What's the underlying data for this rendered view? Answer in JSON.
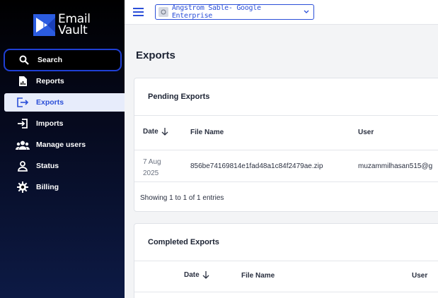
{
  "app": {
    "logo_line1": "Email",
    "logo_line2": "Vault"
  },
  "sidebar": {
    "items": [
      {
        "label": "Search",
        "icon": "search-icon"
      },
      {
        "label": "Reports",
        "icon": "report-icon"
      },
      {
        "label": "Exports",
        "icon": "export-icon"
      },
      {
        "label": "Imports",
        "icon": "import-icon"
      },
      {
        "label": "Manage users",
        "icon": "users-icon"
      },
      {
        "label": "Status",
        "icon": "user-icon"
      },
      {
        "label": "Billing",
        "icon": "gear-icon"
      }
    ]
  },
  "topbar": {
    "tenant": "Angstrom Sable- Google Enterprise"
  },
  "page": {
    "title": "Exports"
  },
  "pending": {
    "title": "Pending Exports",
    "columns": [
      "Date",
      "File Name",
      "User"
    ],
    "rows": [
      {
        "date_line1": "7 Aug",
        "date_line2": "2025",
        "file": "856be74169814e1fad48a1c84f2479ae.zip",
        "user": "muzammilhasan515@g"
      }
    ],
    "footer": "Showing 1 to 1 of 1 entries"
  },
  "completed": {
    "title": "Completed Exports",
    "columns": [
      "Date",
      "File Name",
      "User"
    ]
  },
  "colors": {
    "accent": "#2b4fd8",
    "sidebar_bg": "#05081a",
    "active_bg": "#e7ecfb"
  }
}
